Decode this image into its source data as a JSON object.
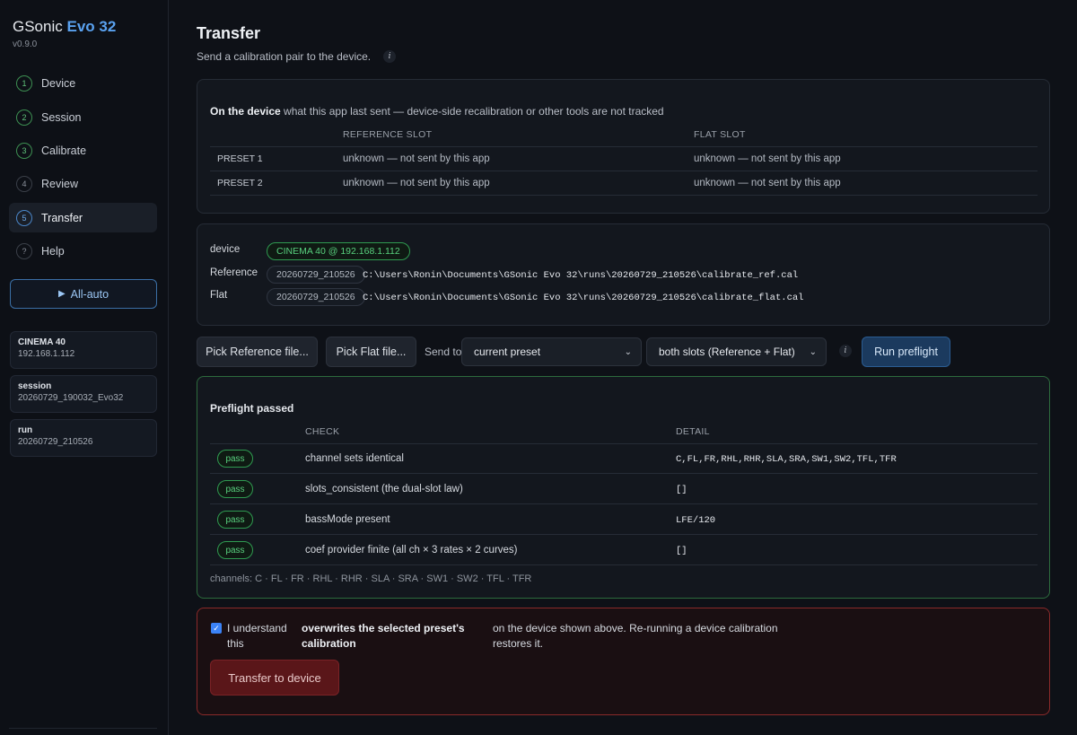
{
  "sidebar": {
    "brand_prefix": "GSonic",
    "brand_accent": "Evo 32",
    "version": "v0.9.0",
    "nav": [
      {
        "num": "1",
        "label": "Device"
      },
      {
        "num": "2",
        "label": "Session"
      },
      {
        "num": "3",
        "label": "Calibrate"
      },
      {
        "num": "4",
        "label": "Review"
      },
      {
        "num": "5",
        "label": "Transfer"
      },
      {
        "num": "?",
        "label": "Help"
      }
    ],
    "allauto_label": "All-auto",
    "cards": [
      {
        "title": "CINEMA 40",
        "value": "192.168.1.112"
      },
      {
        "title": "session",
        "value": "20260729_190032_Evo32"
      },
      {
        "title": "run",
        "value": "20260729_210526"
      }
    ]
  },
  "page": {
    "title": "Transfer",
    "subtitle": "Send a calibration pair to the device.",
    "info_glyph": "i"
  },
  "device_panel": {
    "head_bold": "On the device",
    "head_rest": "what this app last sent — device-side recalibration or other tools are not tracked",
    "col_ref": "REFERENCE SLOT",
    "col_flat": "FLAT SLOT",
    "rows": [
      {
        "label": "PRESET 1",
        "ref": "unknown — not sent by this app",
        "flat": "unknown — not sent by this app"
      },
      {
        "label": "PRESET 2",
        "ref": "unknown — not sent by this app",
        "flat": "unknown — not sent by this app"
      }
    ]
  },
  "files_panel": {
    "device_label": "device",
    "device_value": "CINEMA 40 @ 192.168.1.112",
    "ref_label": "Reference",
    "ref_run": "20260729_210526",
    "ref_path": "C:\\Users\\Ronin\\Documents\\GSonic Evo 32\\runs\\20260729_210526\\calibrate_ref.cal",
    "flat_label": "Flat",
    "flat_run": "20260729_210526",
    "flat_path": "C:\\Users\\Ronin\\Documents\\GSonic Evo 32\\runs\\20260729_210526\\calibrate_flat.cal"
  },
  "toolbar": {
    "pick_ref": "Pick Reference file...",
    "pick_flat": "Pick Flat file...",
    "send_to": "Send to",
    "preset_select": "current preset",
    "slots_select": "both slots (Reference + Flat)",
    "run_preflight": "Run preflight"
  },
  "preflight": {
    "title": "Preflight passed",
    "col_check": "CHECK",
    "col_detail": "DETAIL",
    "rows": [
      {
        "status": "pass",
        "check": "channel sets identical",
        "detail": "C,FL,FR,RHL,RHR,SLA,SRA,SW1,SW2,TFL,TFR"
      },
      {
        "status": "pass",
        "check": "slots_consistent (the dual-slot law)",
        "detail": "[]"
      },
      {
        "status": "pass",
        "check": "bassMode present",
        "detail": "LFE/120"
      },
      {
        "status": "pass",
        "check": "coef provider finite (all ch × 3 rates × 2 curves)",
        "detail": "[]"
      }
    ],
    "channels": "channels: C · FL · FR · RHL · RHR · SLA · SRA · SW1 · SW2 · TFL · TFR"
  },
  "confirm": {
    "checked": true,
    "check_glyph": "✓",
    "text_a1": "I understand",
    "text_a2": "this",
    "text_b1": "overwrites the selected preset's",
    "text_b2": "calibration",
    "text_c1": "on the device shown above. Re-running a device calibration",
    "text_c2": "restores it.",
    "button": "Transfer to device"
  },
  "colors": {
    "accent": "#5aa2f0",
    "pass": "#58d07e",
    "danger": "#8a2a2a"
  }
}
